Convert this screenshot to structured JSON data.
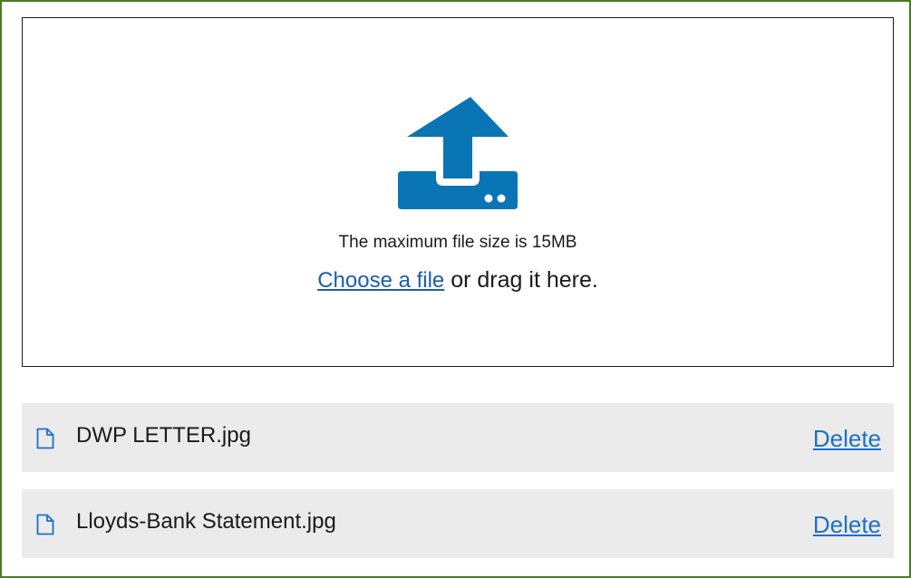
{
  "upload": {
    "icon": "upload-tray-icon",
    "max_size_text": "The maximum file size is 15MB",
    "choose_link": "Choose a file",
    "drag_text": " or drag it here."
  },
  "files": [
    {
      "icon": "file-icon",
      "name": "DWP LETTER.jpg",
      "delete_label": "Delete"
    },
    {
      "icon": "file-icon",
      "name": "Lloyds-Bank Statement.jpg",
      "delete_label": "Delete"
    }
  ],
  "colors": {
    "accent": "#0a75b5",
    "link": "#1d70c8",
    "frame_border": "#4a7a2a",
    "row_bg": "#ebebeb"
  }
}
